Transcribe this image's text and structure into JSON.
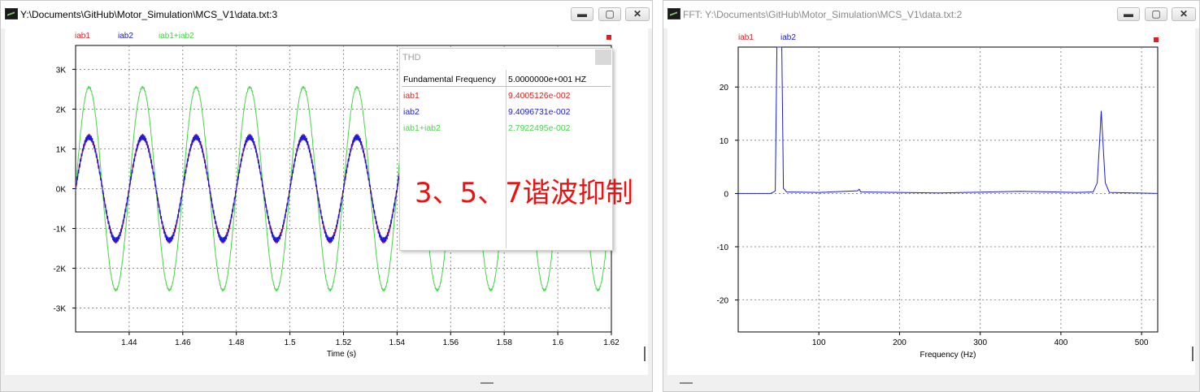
{
  "colors": {
    "iab1": "#e02020",
    "iab2": "#1a1adc",
    "sum": "#44d644"
  },
  "left_window": {
    "title": "Y:\\Documents\\GitHub\\Motor_Simulation\\MCS_V1\\data.txt:3",
    "legend": [
      "iab1",
      "iab2",
      "iab1+iab2"
    ],
    "buttons": {
      "minimize": "▬",
      "maximize": "▢",
      "close": "✕"
    }
  },
  "right_window": {
    "title": "FFT:  Y:\\Documents\\GitHub\\Motor_Simulation\\MCS_V1\\data.txt:2",
    "legend": [
      "iab1",
      "iab2"
    ],
    "buttons": {
      "minimize": "▬",
      "maximize": "▢",
      "close": "✕"
    }
  },
  "thd_panel": {
    "title": "THD",
    "header_label": "Fundamental Frequency",
    "header_value": "5.0000000e+001 HZ",
    "rows": [
      {
        "name": "iab1",
        "value": "9.4005126e-002"
      },
      {
        "name": "iab2",
        "value": "9.4096731e-002"
      },
      {
        "name": "iab1+iab2",
        "value": "2.7922495e-002"
      }
    ]
  },
  "annotation": "3、5、7谐波抑制",
  "chart_data": [
    {
      "type": "line",
      "title": "",
      "xlabel": "Time (s)",
      "ylabel": "",
      "xlim": [
        1.42,
        1.62
      ],
      "ylim": [
        -3.6,
        3.6
      ],
      "x_ticks": [
        1.44,
        1.46,
        1.48,
        1.5,
        1.52,
        1.54,
        1.56,
        1.58,
        1.6,
        1.62
      ],
      "x_tick_labels": [
        "1.44",
        "1.46",
        "1.48",
        "1.5",
        "1.52",
        "1.54",
        "1.56",
        "1.58",
        "1.6",
        "1.62"
      ],
      "y_ticks": [
        3,
        2,
        1,
        0,
        -1,
        -2,
        -3
      ],
      "y_tick_labels": [
        "3K",
        "2K",
        "1K",
        "0K",
        "-1K",
        "-2K",
        "-3K"
      ],
      "grid": true,
      "frequency_hz": 50,
      "series": [
        {
          "name": "iab1",
          "amplitude": 1.3,
          "ripple": 0.08
        },
        {
          "name": "iab2",
          "amplitude": 1.3,
          "ripple": 0.08
        },
        {
          "name": "iab1+iab2",
          "amplitude": 2.55,
          "ripple": 0.03
        }
      ]
    },
    {
      "type": "line",
      "title": "",
      "xlabel": "Frequency (Hz)",
      "ylabel": "",
      "xlim": [
        0,
        520
      ],
      "ylim": [
        -26,
        27.5
      ],
      "x_ticks": [
        100,
        200,
        300,
        400,
        500
      ],
      "x_tick_labels": [
        "100",
        "200",
        "300",
        "400",
        "500"
      ],
      "y_ticks": [
        20,
        10,
        0,
        -10,
        -20
      ],
      "y_tick_labels": [
        "20",
        "10",
        "0",
        "-10",
        "-20"
      ],
      "grid": true,
      "series": [
        {
          "name": "iab2",
          "x": [
            0,
            40,
            44,
            46,
            48,
            50,
            52,
            54,
            56,
            60,
            100,
            148,
            150,
            152,
            250,
            350,
            390,
            420,
            440,
            445,
            448,
            450,
            452,
            455,
            460,
            520
          ],
          "y": [
            0,
            0,
            0.3,
            0.5,
            28,
            28,
            28,
            28,
            1,
            0.3,
            0.2,
            0.5,
            0.8,
            0.3,
            0.1,
            0.4,
            0.3,
            0.2,
            0.3,
            2,
            10,
            15.5,
            10,
            2,
            0.2,
            0
          ]
        }
      ]
    }
  ]
}
